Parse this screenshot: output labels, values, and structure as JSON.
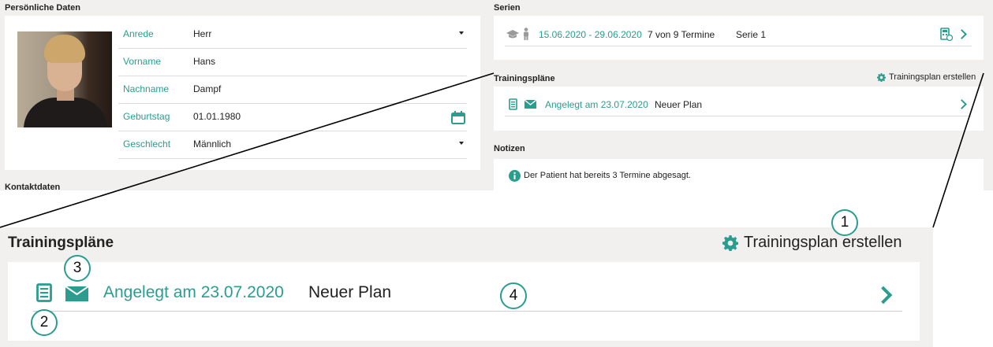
{
  "personal": {
    "title": "Persönliche Daten",
    "fields": [
      {
        "label": "Anrede",
        "value": "Herr"
      },
      {
        "label": "Vorname",
        "value": "Hans"
      },
      {
        "label": "Nachname",
        "value": "Dampf"
      },
      {
        "label": "Geburtstag",
        "value": "01.01.1980"
      },
      {
        "label": "Geschlecht",
        "value": "Männlich"
      }
    ],
    "contact_title": "Kontaktdaten"
  },
  "series": {
    "title": "Serien",
    "date_range": "15.06.2020 - 29.06.2020",
    "appointments": "7 von 9 Termine",
    "name": "Serie 1"
  },
  "training": {
    "title": "Trainingspläne",
    "create_label": "Trainingsplan erstellen",
    "plans": [
      {
        "created": "Angelegt am 23.07.2020",
        "name": "Neuer Plan"
      }
    ]
  },
  "notes": {
    "title": "Notizen",
    "text": "Der Patient hat bereits 3 Termine abgesagt."
  },
  "callouts": [
    "1",
    "2",
    "3",
    "4"
  ],
  "colors": {
    "accent": "#2a9d8f",
    "panel_bg": "#f2f0ee",
    "card_bg": "#ffffff"
  }
}
